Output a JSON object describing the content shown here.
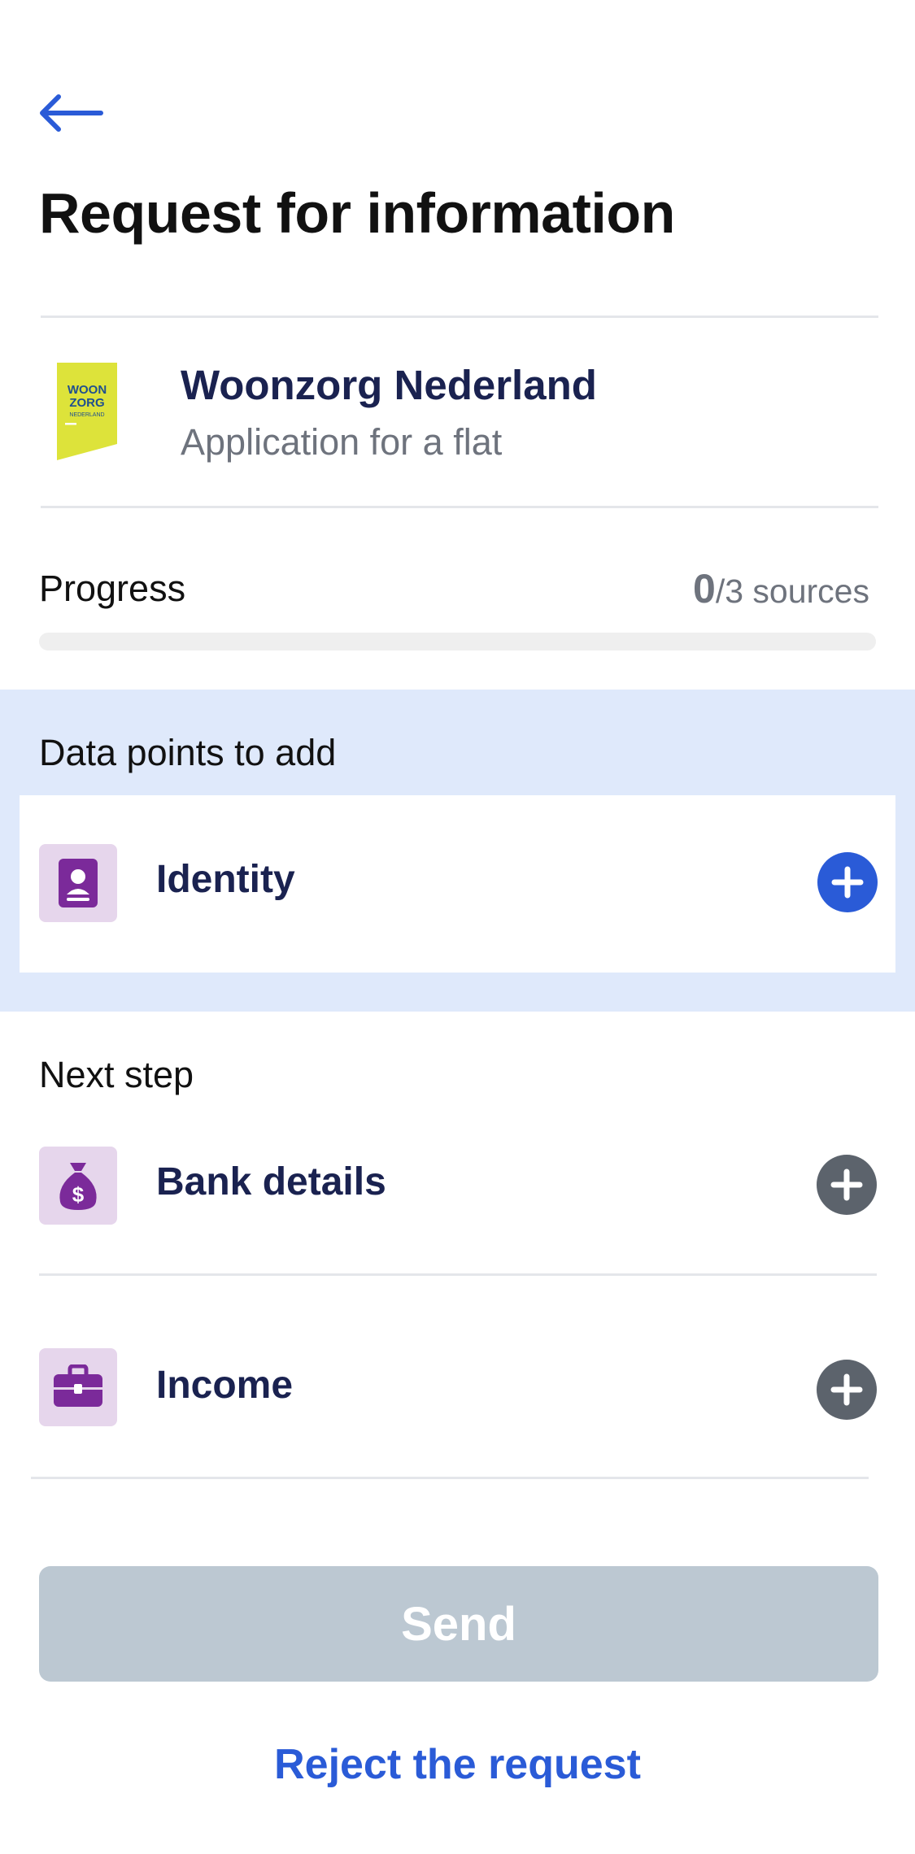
{
  "header": {
    "back_icon": "arrow-left-icon",
    "title": "Request for information"
  },
  "requester": {
    "logo_text": [
      "WOON",
      "ZORG",
      "NEDERLAND"
    ],
    "logo_color": "#dde33a",
    "name": "Woonzorg Nederland",
    "subtitle": "Application for a flat"
  },
  "progress": {
    "label": "Progress",
    "completed": "0",
    "total_text": "/3 sources",
    "fraction": 0
  },
  "data_points": {
    "title": "Data points to add",
    "items": [
      {
        "label": "Identity",
        "icon": "id-card-icon",
        "action_icon": "plus-circle-icon"
      }
    ]
  },
  "next_step": {
    "title": "Next step",
    "items": [
      {
        "label": "Bank details",
        "icon": "money-bag-icon",
        "action_icon": "plus-circle-icon"
      },
      {
        "label": "Income",
        "icon": "briefcase-icon",
        "action_icon": "plus-circle-icon"
      }
    ]
  },
  "actions": {
    "send_label": "Send",
    "reject_label": "Reject the request"
  },
  "colors": {
    "accent": "#2a5bd7",
    "highlight_bg": "#dfe9fb",
    "icon_purple": "#7b2a9a",
    "icon_bg": "#e6d6ec",
    "disabled_button": "#bcc8d2",
    "inactive_add": "#5c636c"
  }
}
